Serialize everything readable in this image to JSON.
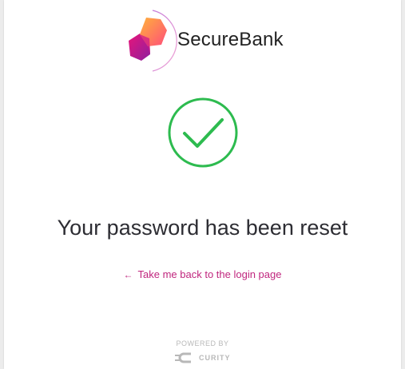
{
  "brand": {
    "name": "SecureBank",
    "accent_colors": [
      "#ff6f3c",
      "#e8157a",
      "#a1159c"
    ]
  },
  "status": {
    "icon": "check-circle-icon",
    "color": "#2dbb4f"
  },
  "main": {
    "title": "Your password has been reset",
    "back_link": "Take me back to the login page",
    "link_color": "#c0267e"
  },
  "footer": {
    "powered_by": "POWERED BY",
    "provider_name": "CURITY"
  }
}
